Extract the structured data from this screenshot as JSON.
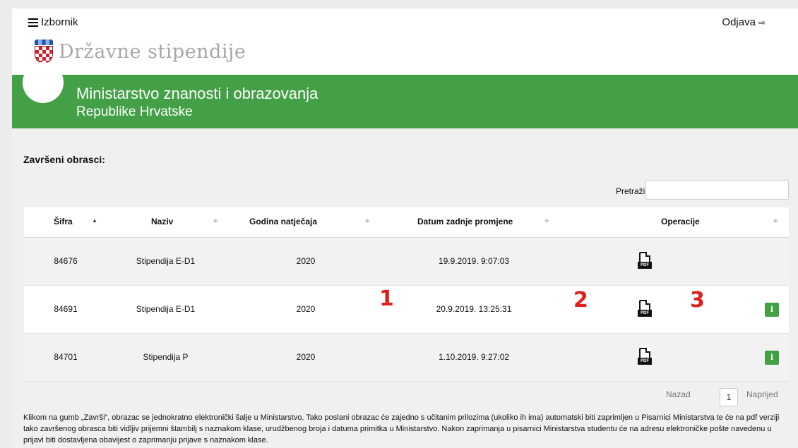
{
  "header": {
    "menu_label": "Izbornik",
    "logout_label": "Odjava",
    "brand_name": "Državne stipendije",
    "banner_title": "Ministarstvo znanosti i obrazovanja",
    "banner_subtitle": "Republike Hrvatske",
    "accent_color": "#44a047"
  },
  "main": {
    "section_title": "Završeni obrasci:",
    "search_label": "Pretraži:",
    "search_value": "",
    "columns": [
      "Šifra",
      "Naziv",
      "Godina natječaja",
      "Datum zadnje promjene",
      "Operacije"
    ],
    "rows": [
      {
        "sifra": "84676",
        "naziv": "Stipendija E-D1",
        "godina": "2020",
        "datum": "19.9.2019. 9:07:03",
        "pdf": true,
        "info": false
      },
      {
        "sifra": "84691",
        "naziv": "Stipendija E-D1",
        "godina": "2020",
        "datum": "20.9.2019. 13:25:31",
        "pdf": true,
        "info": true
      },
      {
        "sifra": "84701",
        "naziv": "Stipendija P",
        "godina": "2020",
        "datum": "1.10.2019. 9:27:02",
        "pdf": true,
        "info": true
      }
    ],
    "pdf_tag": "PDF",
    "info_glyph": "i",
    "annotations": [
      "1",
      "2",
      "3"
    ],
    "pagination": {
      "prev": "Nazad",
      "current": "1",
      "next": "Naprijed"
    },
    "footnote": "Klikom na gumb „Završi“, obrazac se jednokratno elektronički šalje u Ministarstvo. Tako poslani obrazac će zajedno s učitanim prilozima (ukoliko ih ima) automatski biti zaprimljen u Pisarnici Ministarstva te će na pdf verziji tako završenog obrasca biti vidljiv prijemni štambilj s naznakom klase, urudžbenog broja i datuma primitka u Ministarstvo. Nakon zaprimanja u pisarnici Ministarstva studentu će na adresu elektroničke pošte navedenu u prijavi biti dostavljena obavijest o zaprimanju prijave s naznakom klase."
  }
}
